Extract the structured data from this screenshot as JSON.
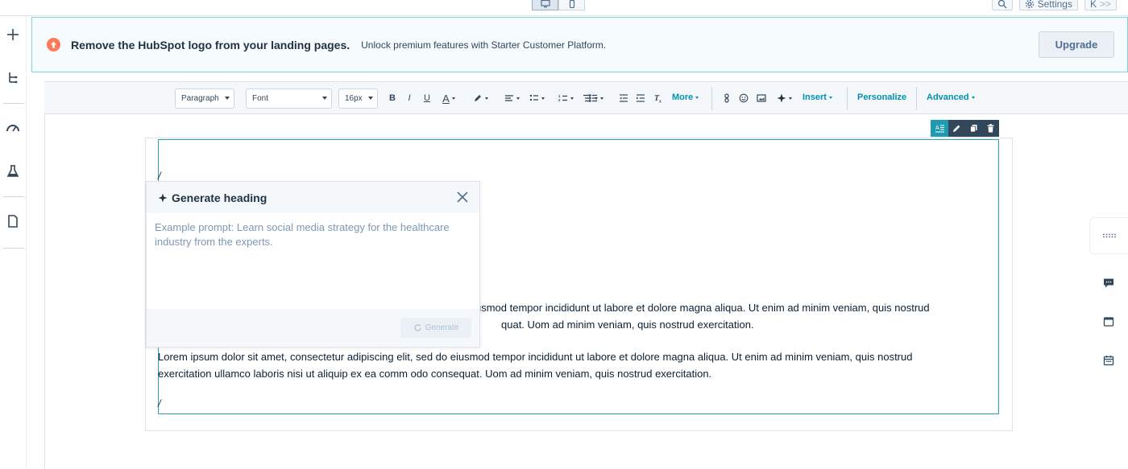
{
  "topbar": {
    "settings_label": "Settings",
    "collapse_label": "K",
    "expand_label": ">>"
  },
  "banner": {
    "title": "Remove the HubSpot logo from your landing pages.",
    "subtitle": "Unlock premium features with Starter Customer Platform.",
    "upgrade_label": "Upgrade",
    "icon": "arrow-up-circle-icon"
  },
  "toolbar": {
    "paragraph_value": "Paragraph",
    "font_value": "Font",
    "size_value": "16px",
    "bold": "B",
    "italic": "I",
    "underline": "U",
    "text_color": "A",
    "more_label": "More",
    "insert_label": "Insert",
    "personalize_label": "Personalize",
    "advanced_label": "Advanced"
  },
  "content": {
    "cursor_top": "/",
    "cursor_bottom": "/",
    "para1_line1": "usmod tempor incididunt ut labore et dolore magna aliqua. Ut enim ad minim veniam, quis nostrud",
    "para1_line2": "quat. Uom ad minim veniam, quis nostrud exercitation.",
    "para2_line1": "Lorem ipsum dolor sit amet, consectetur adipiscing elit, sed do eiusmod tempor incididunt ut labore et dolore magna aliqua. Ut enim ad minim veniam, quis nostrud",
    "para2_line2": "exercitation ullamco laboris nisi ut aliquip ex ea comm odo consequat. Uom ad minim veniam, quis nostrud exercitation."
  },
  "popover": {
    "title": "Generate heading",
    "placeholder": "Example prompt: Learn social media strategy for the healthcare industry from the experts.",
    "generate_label": "Generate"
  },
  "colors": {
    "accent": "#0091ae",
    "banner_border": "#7fd1de",
    "alert": "#ff7a59",
    "module_border": "#2a9fb7"
  }
}
